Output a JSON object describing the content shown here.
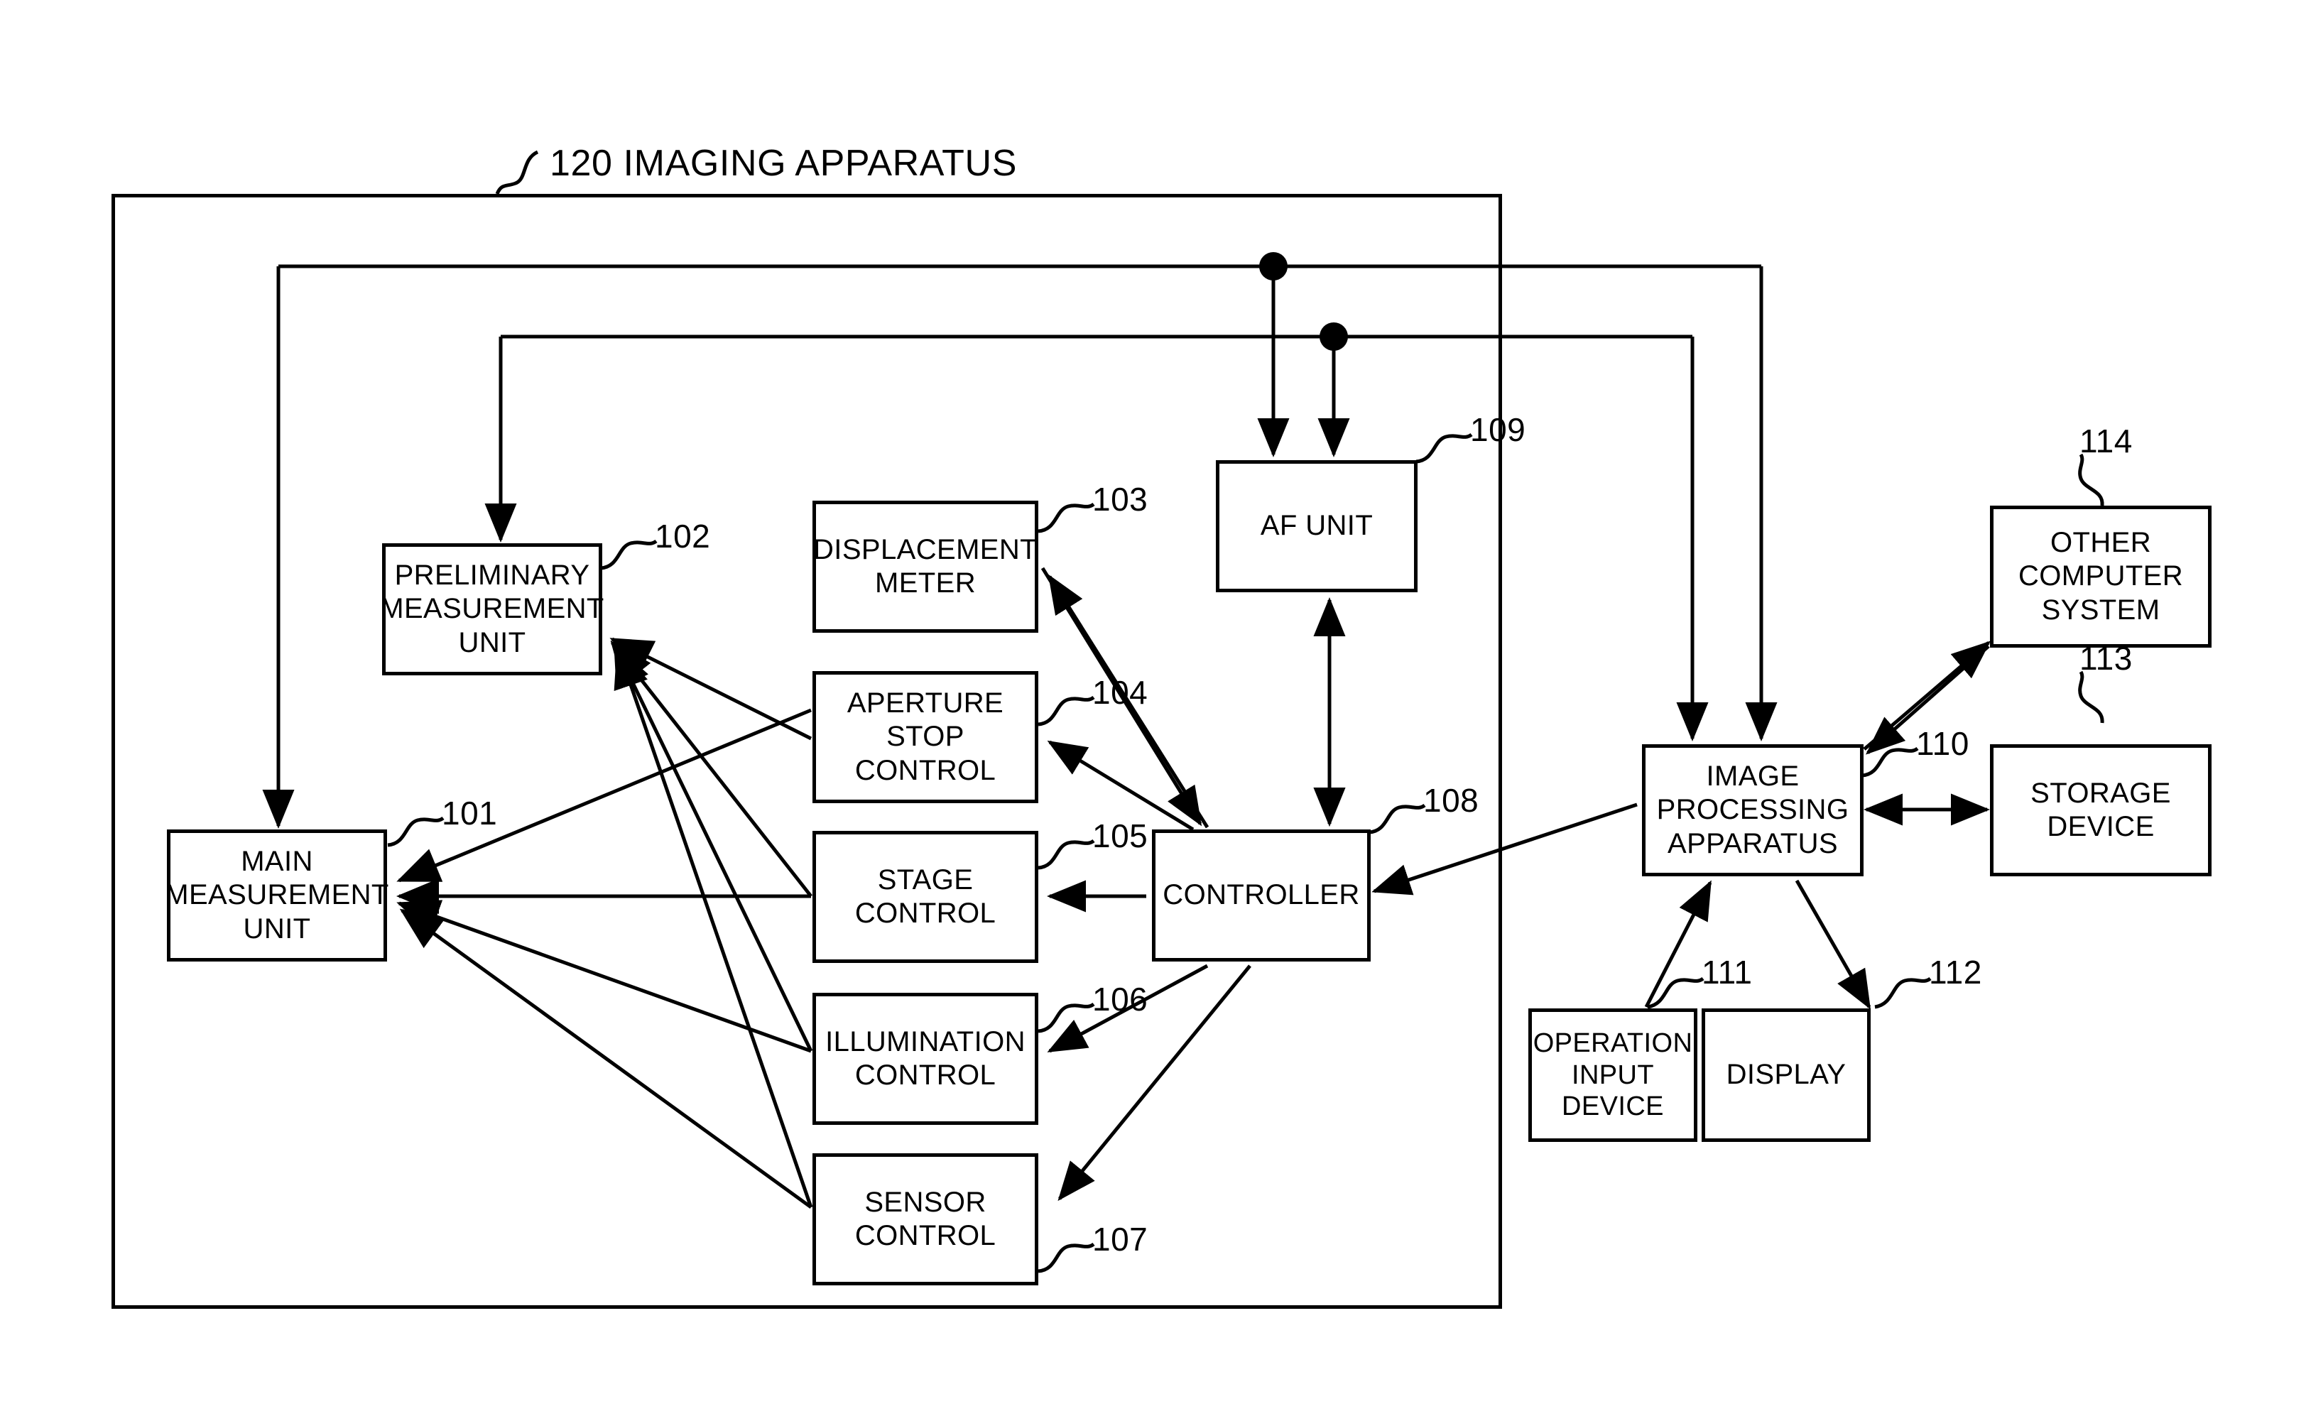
{
  "figure": {
    "title": "120 IMAGING APPARATUS",
    "title_ref": "120",
    "title_text": "IMAGING APPARATUS",
    "line_color": "#000000",
    "background_color": "#ffffff"
  },
  "nodes": {
    "main_measurement_unit": {
      "label": "MAIN\nMEASUREMENT\nUNIT",
      "ref": "101"
    },
    "preliminary_measurement_unit": {
      "label": "PRELIMINARY\nMEASUREMENT\nUNIT",
      "ref": "102"
    },
    "displacement_meter": {
      "label": "DISPLACEMENT\nMETER",
      "ref": "103"
    },
    "aperture_stop_control": {
      "label": "APERTURE\nSTOP CONTROL",
      "ref": "104"
    },
    "stage_control": {
      "label": "STAGE\nCONTROL",
      "ref": "105"
    },
    "illumination_control": {
      "label": "ILLUMINATION\nCONTROL",
      "ref": "106"
    },
    "sensor_control": {
      "label": "SENSOR\nCONTROL",
      "ref": "107"
    },
    "controller": {
      "label": "CONTROLLER",
      "ref": "108"
    },
    "af_unit": {
      "label": "AF UNIT",
      "ref": "109"
    },
    "image_processing_apparatus": {
      "label": "IMAGE\nPROCESSING\nAPPARATUS",
      "ref": "110"
    },
    "operation_input_device": {
      "label": "OPERATION\nINPUT DEVICE",
      "ref": "111"
    },
    "display": {
      "label": "DISPLAY",
      "ref": "112"
    },
    "storage_device": {
      "label": "STORAGE\nDEVICE",
      "ref": "113"
    },
    "other_computer_system": {
      "label": "OTHER\nCOMPUTER\nSYSTEM",
      "ref": "114"
    }
  }
}
